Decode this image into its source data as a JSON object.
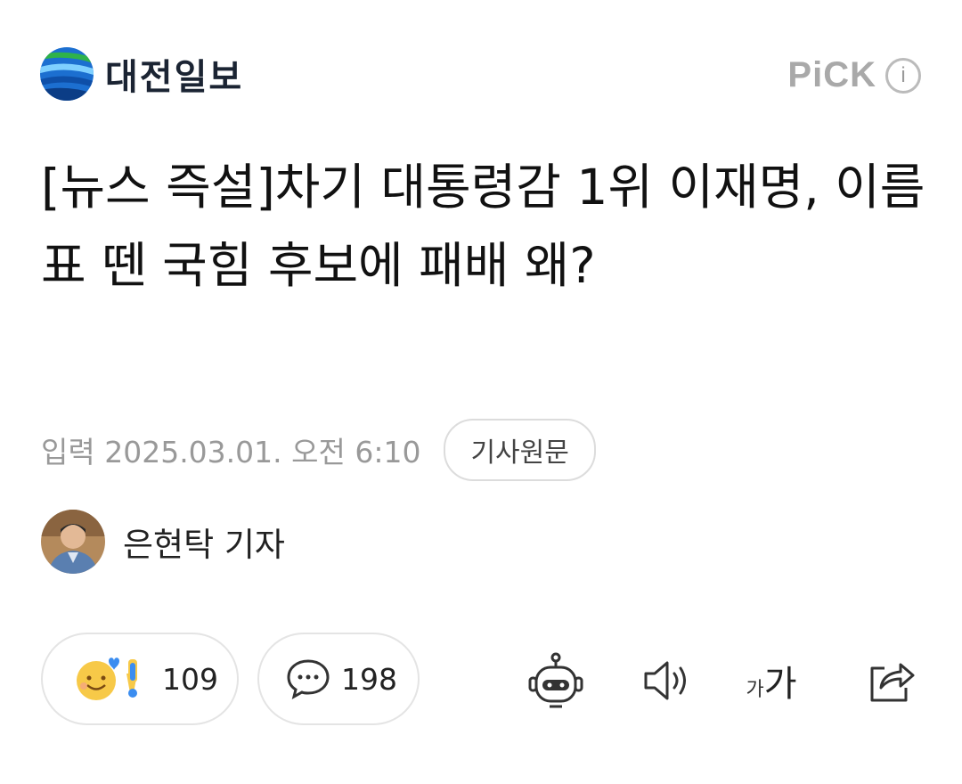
{
  "header": {
    "logo_text": "대전일보",
    "pick_label": "PiCK",
    "pick_info": "i"
  },
  "article": {
    "headline": "[뉴스 즉설]차기 대통령감 1위 이재명, 이름표 뗀 국힘 후보에 패배 왜?",
    "date": "입력 2025.03.01. 오전 6:10",
    "original_button": "기사원문",
    "reporter_name": "은현탁 기자"
  },
  "actions": {
    "reaction_count": "109",
    "comment_count": "198",
    "font_small": "가",
    "font_big": "가"
  },
  "icons": {
    "globe": "logo-globe-icon",
    "reaction": "reaction-emoji-icon",
    "comment": "speech-bubble-icon",
    "bot": "robot-summary-icon",
    "tts": "speaker-icon",
    "font": "font-size-icon",
    "share": "share-icon"
  },
  "colors": {
    "logo_text": "#1b2433",
    "pick": "#a9a9a9",
    "meta_text": "#999999",
    "reaction_heart": "#3b8df0",
    "reaction_face": "#f7c948"
  }
}
